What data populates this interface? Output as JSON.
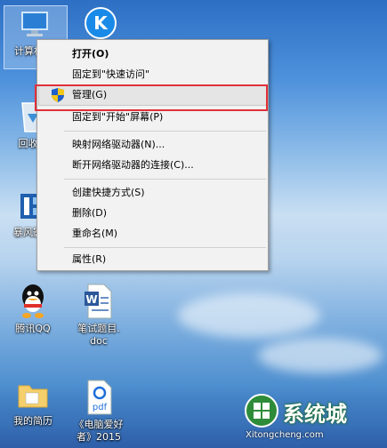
{
  "desktop": {
    "icons": [
      {
        "id": "computer",
        "label": "计算机"
      },
      {
        "id": "kugou",
        "label": ""
      },
      {
        "id": "recycle",
        "label": "回收站"
      },
      {
        "id": "baofeng",
        "label": "暴风影音"
      },
      {
        "id": "qq",
        "label": "腾讯QQ"
      },
      {
        "id": "doc",
        "label": "笔试题目.",
        "label2": "doc"
      },
      {
        "id": "folder",
        "label": "我的简历"
      },
      {
        "id": "pdf",
        "label": "《电脑爱好",
        "label2": "者》2015"
      }
    ]
  },
  "context_menu": {
    "items": [
      {
        "label": "打开(O)",
        "bold": true
      },
      {
        "label": "固定到\"快速访问\""
      },
      {
        "label": "管理(G)",
        "icon": "shield-icon",
        "highlighted": true
      },
      {
        "label": "固定到\"开始\"屏幕(P)"
      },
      {
        "label": "映射网络驱动器(N)..."
      },
      {
        "label": "断开网络驱动器的连接(C)..."
      },
      {
        "label": "创建快捷方式(S)"
      },
      {
        "label": "删除(D)"
      },
      {
        "label": "重命名(M)"
      },
      {
        "label": "属性(R)"
      }
    ]
  },
  "watermark": {
    "text": "系统城",
    "subtext": "Xitongcheng.com"
  },
  "colors": {
    "highlight_border": "#e0303a",
    "menu_bg": "#f2f2f2"
  }
}
